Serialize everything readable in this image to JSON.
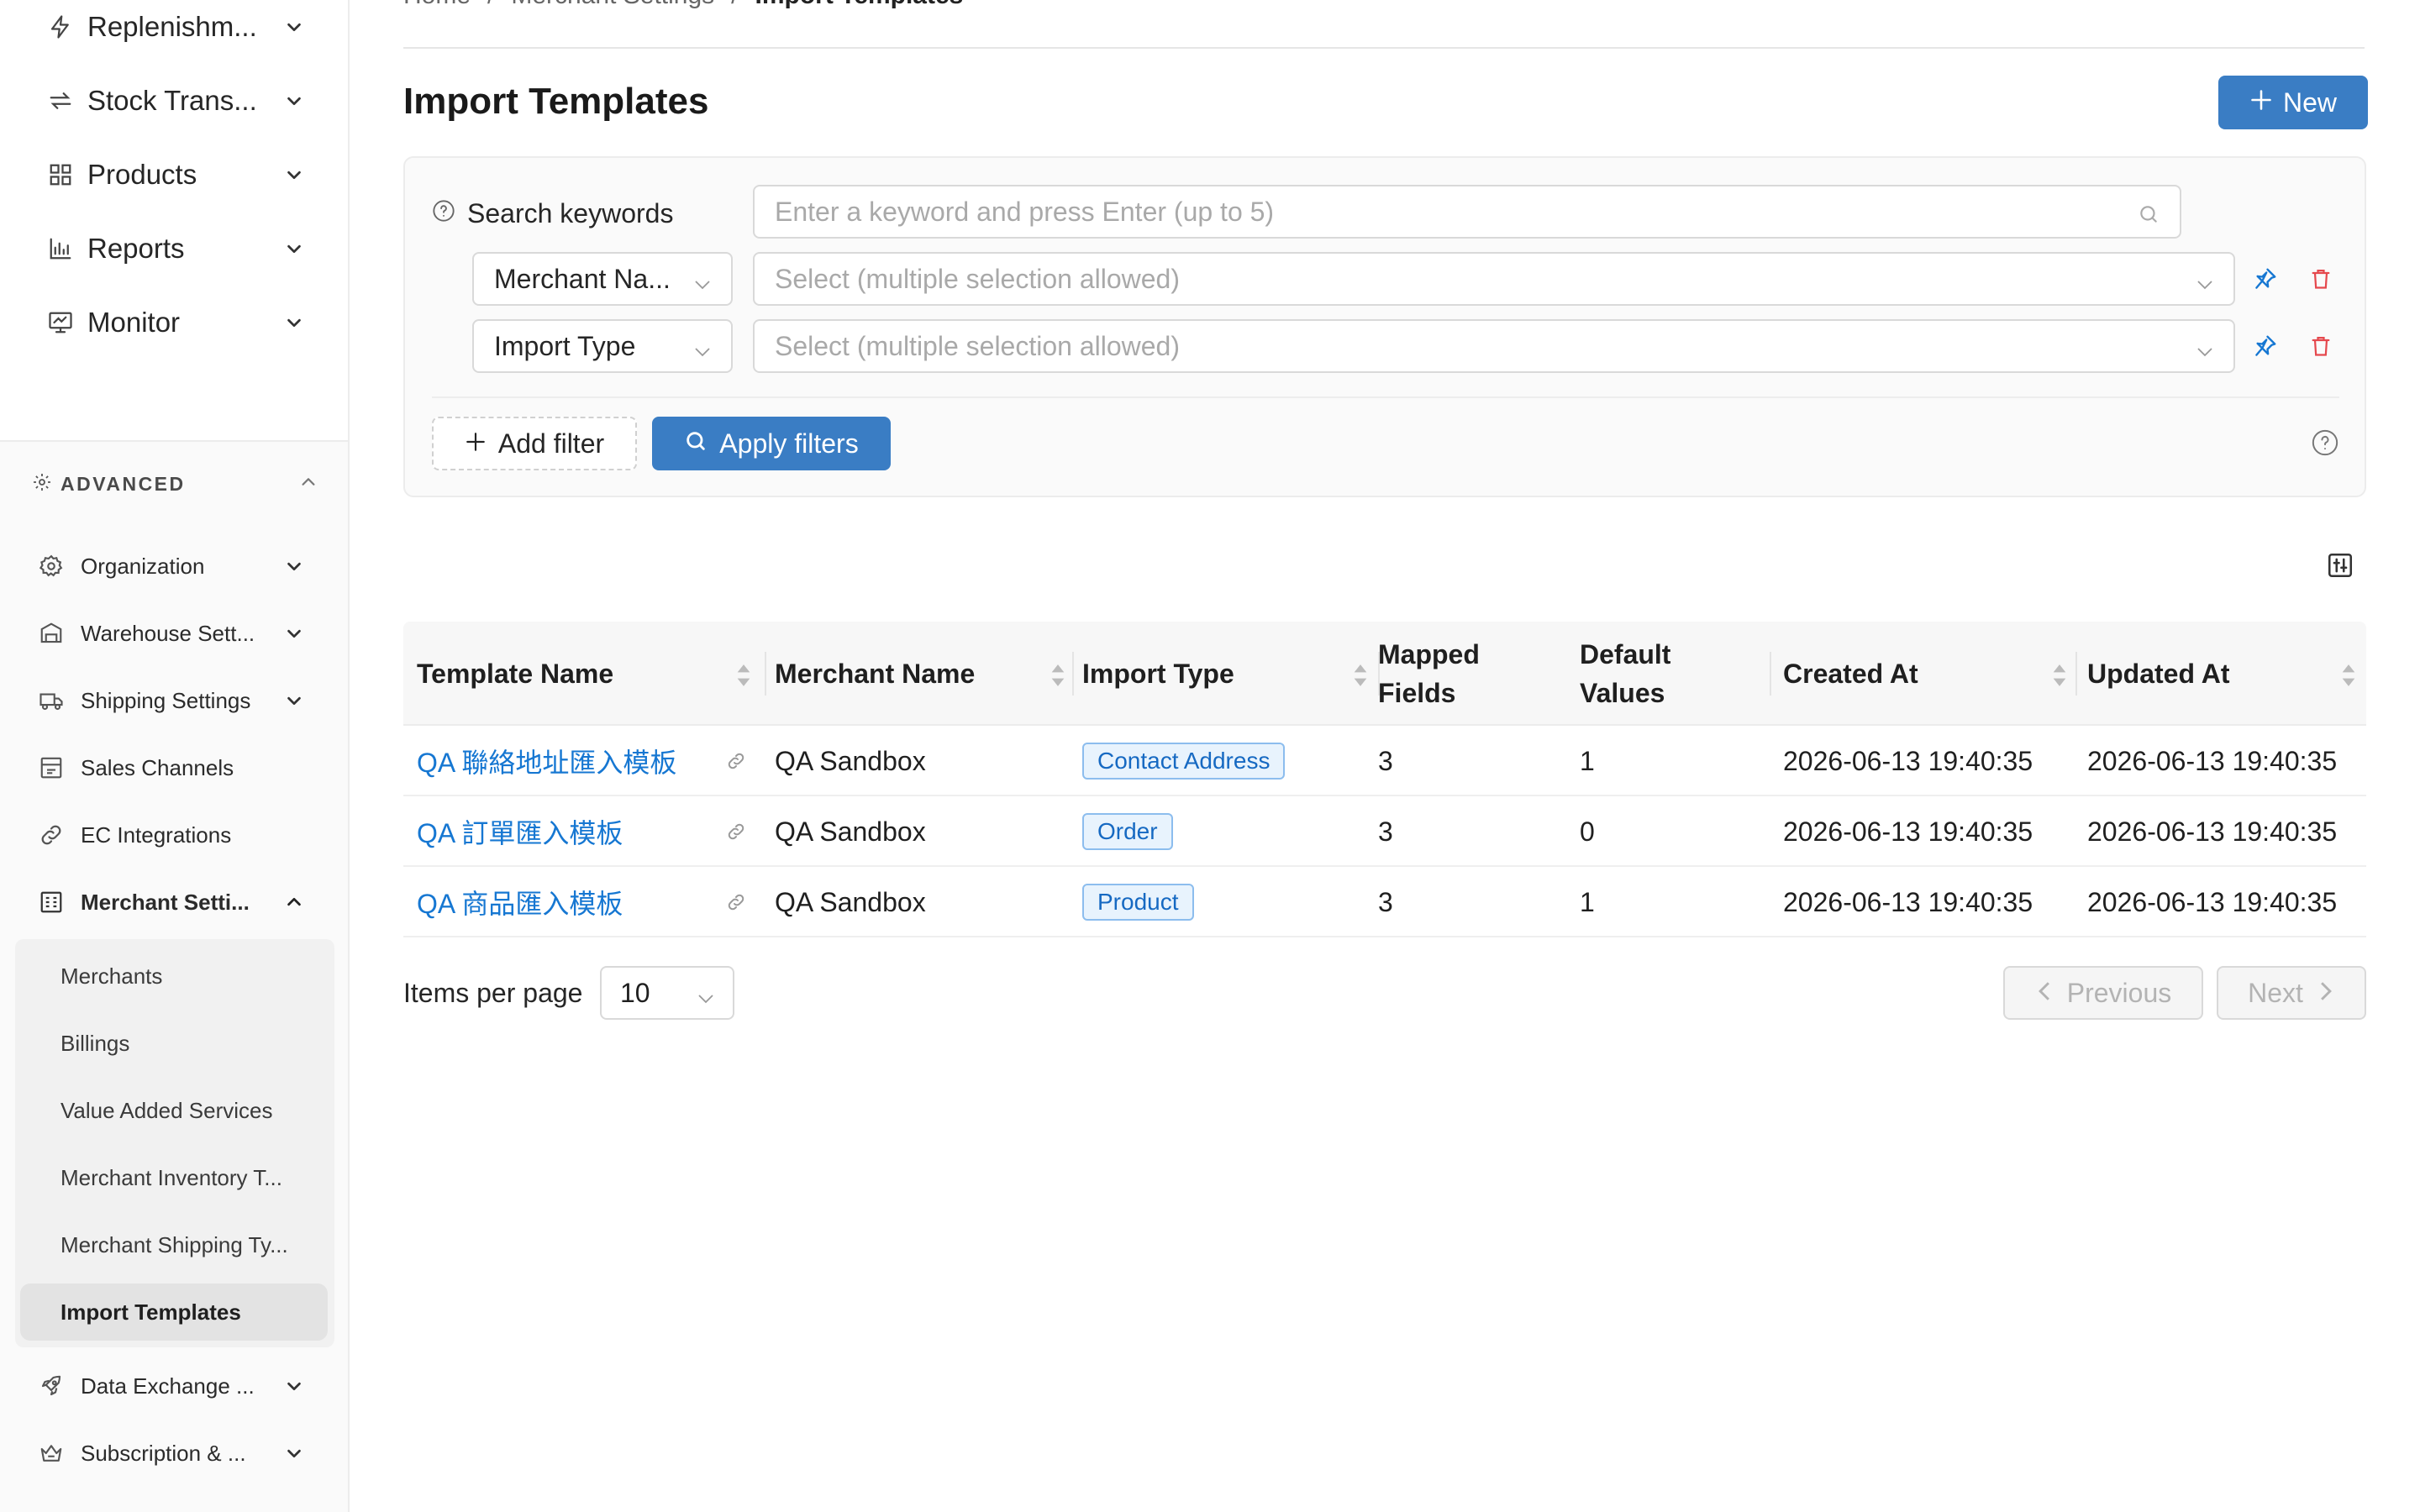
{
  "sidebar": {
    "top_items": [
      {
        "label": "Replenishm...",
        "icon": "bolt-icon"
      },
      {
        "label": "Stock Trans...",
        "icon": "transfer-icon"
      },
      {
        "label": "Products",
        "icon": "grid-icon"
      },
      {
        "label": "Reports",
        "icon": "bar-chart-icon"
      },
      {
        "label": "Monitor",
        "icon": "monitor-icon"
      }
    ],
    "advanced_label": "ADVANCED",
    "advanced_items": [
      {
        "label": "Organization",
        "icon": "gear-icon"
      },
      {
        "label": "Warehouse Sett...",
        "icon": "warehouse-icon"
      },
      {
        "label": "Shipping Settings",
        "icon": "truck-icon"
      },
      {
        "label": "Sales Channels",
        "icon": "store-icon"
      },
      {
        "label": "EC Integrations",
        "icon": "link-icon"
      },
      {
        "label": "Merchant Setti...",
        "icon": "merchant-icon"
      }
    ],
    "merchant_sub_items": [
      {
        "label": "Merchants"
      },
      {
        "label": "Billings"
      },
      {
        "label": "Value Added Services"
      },
      {
        "label": "Merchant Inventory T..."
      },
      {
        "label": "Merchant Shipping Ty..."
      },
      {
        "label": "Import Templates"
      }
    ],
    "bottom_items": [
      {
        "label": "Data Exchange ...",
        "icon": "rocket-icon"
      },
      {
        "label": "Subscription & ...",
        "icon": "crown-icon"
      }
    ]
  },
  "breadcrumb": [
    "Home",
    "Merchant Settings",
    "Import Templates"
  ],
  "breadcrumb_sep": "/",
  "page": {
    "title": "Import Templates",
    "new_label": "New"
  },
  "filters": {
    "keywords_label": "Search keywords",
    "keywords_placeholder": "Enter a keyword and press Enter (up to 5)",
    "rows": [
      {
        "field": "Merchant Na...",
        "placeholder": "Select (multiple selection allowed)"
      },
      {
        "field": "Import Type",
        "placeholder": "Select (multiple selection allowed)"
      }
    ],
    "add_filter_label": "Add filter",
    "apply_label": "Apply filters"
  },
  "table": {
    "columns": [
      {
        "label": "Template Name",
        "sortable": true
      },
      {
        "label": "Merchant Name",
        "sortable": true
      },
      {
        "label": "Import Type",
        "sortable": true
      },
      {
        "label": "Mapped Fields",
        "sortable": false
      },
      {
        "label": "Default Values",
        "sortable": false
      },
      {
        "label": "Created At",
        "sortable": true
      },
      {
        "label": "Updated At",
        "sortable": true
      }
    ],
    "rows": [
      {
        "template": "QA 聯絡地址匯入模板",
        "merchant": "QA Sandbox",
        "type": "Contact Address",
        "mapped": "3",
        "defaults": "1",
        "created": "2026-06-13 19:40:35",
        "updated": "2026-06-13 19:40:35"
      },
      {
        "template": "QA 訂單匯入模板",
        "merchant": "QA Sandbox",
        "type": "Order",
        "mapped": "3",
        "defaults": "0",
        "created": "2026-06-13 19:40:35",
        "updated": "2026-06-13 19:40:35"
      },
      {
        "template": "QA 商品匯入模板",
        "merchant": "QA Sandbox",
        "type": "Product",
        "mapped": "3",
        "defaults": "1",
        "created": "2026-06-13 19:40:35",
        "updated": "2026-06-13 19:40:35"
      }
    ]
  },
  "pagination": {
    "items_per_page_label": "Items per page",
    "items_per_page": "10",
    "previous_label": "Previous",
    "next_label": "Next"
  },
  "colors": {
    "primary": "#3a7dc4",
    "link": "#1677d2",
    "danger": "#e5484d",
    "pin": "#1677d2"
  }
}
